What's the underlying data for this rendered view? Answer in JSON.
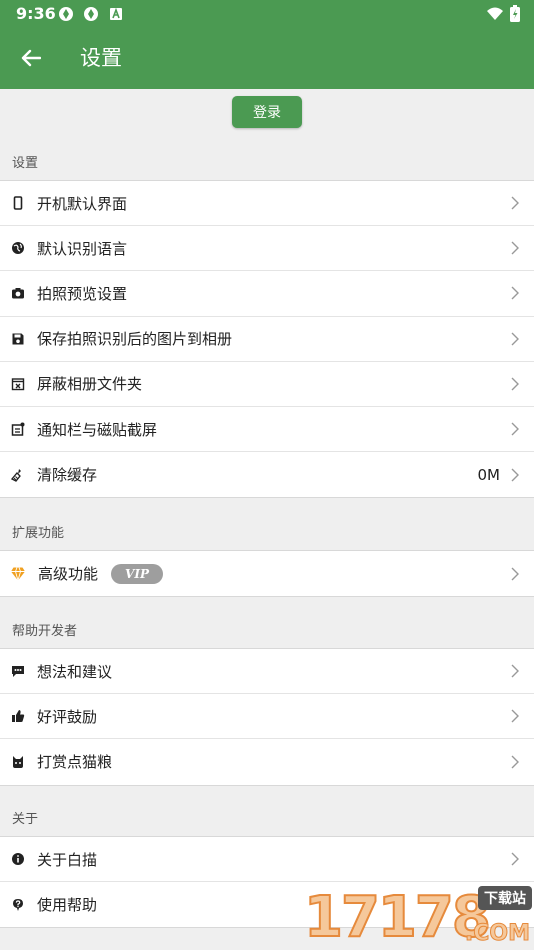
{
  "status_bar": {
    "time": "9:36"
  },
  "toolbar": {
    "title": "设置"
  },
  "login_button": "登录",
  "sections": {
    "settings": {
      "header": "设置",
      "items": [
        {
          "label": "开机默认界面",
          "icon": "phone-icon"
        },
        {
          "label": "默认识别语言",
          "icon": "globe-icon"
        },
        {
          "label": "拍照预览设置",
          "icon": "camera-icon"
        },
        {
          "label": "保存拍照识别后的图片到相册",
          "icon": "save-icon"
        },
        {
          "label": "屏蔽相册文件夹",
          "icon": "folder-block-icon"
        },
        {
          "label": "通知栏与磁贴截屏",
          "icon": "notification-icon"
        },
        {
          "label": "清除缓存",
          "icon": "broom-icon",
          "value": "0M"
        }
      ]
    },
    "extensions": {
      "header": "扩展功能",
      "items": [
        {
          "label": "高级功能",
          "icon": "diamond-icon",
          "badge": "VIP"
        }
      ]
    },
    "help_dev": {
      "header": "帮助开发者",
      "items": [
        {
          "label": "想法和建议",
          "icon": "chat-icon"
        },
        {
          "label": "好评鼓励",
          "icon": "thumbs-up-icon"
        },
        {
          "label": "打赏点猫粮",
          "icon": "cat-icon"
        }
      ]
    },
    "about": {
      "header": "关于",
      "items": [
        {
          "label": "关于白描",
          "icon": "info-icon"
        },
        {
          "label": "使用帮助",
          "icon": "help-icon"
        }
      ]
    }
  },
  "watermark": {
    "number": "17178",
    "tag": "下载站",
    "domain": ".COM"
  },
  "colors": {
    "primary": "#4b9a52",
    "background": "#efefef",
    "vip_badge": "#9e9e9e",
    "diamond": "#f0a020"
  }
}
